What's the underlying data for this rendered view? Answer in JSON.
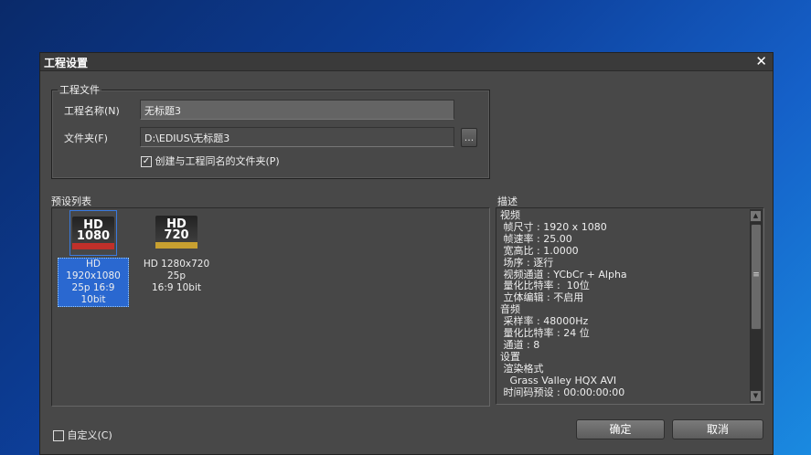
{
  "dialog": {
    "title": "工程设置",
    "close": "✕"
  },
  "project_file": {
    "legend": "工程文件",
    "name_label": "工程名称(N)",
    "name_value": "无标题3",
    "folder_label": "文件夹(F)",
    "folder_value": "D:\\EDIUS\\无标题3",
    "browse": "...",
    "create_folder_label": "创建与工程同名的文件夹(P)",
    "create_folder_checked": true
  },
  "presets": {
    "label": "预设列表",
    "items": [
      {
        "badge_top": "HD",
        "badge_bottom": "1080",
        "line1": "HD 1920x1080",
        "line2": "25p 16:9 10bit",
        "selected": true,
        "stripe": "#c0302a"
      },
      {
        "badge_top": "HD",
        "badge_bottom": "720",
        "line1": "HD 1280x720 25p",
        "line2": "16:9 10bit",
        "selected": false,
        "stripe": "#c8a030"
      }
    ]
  },
  "description": {
    "label": "描述",
    "lines": [
      "视频",
      " 帧尺寸 : 1920 x 1080",
      " 帧速率 : 25.00",
      " 宽高比 : 1.0000",
      " 场序 : 逐行",
      " 视频通道 : YCbCr + Alpha",
      " 量化比特率 :  10位",
      " 立体编辑 : 不启用",
      "音频",
      " 采样率 : 48000Hz",
      " 量化比特率 : 24 位",
      " 通道 : 8",
      "设置",
      " 渲染格式",
      "   Grass Valley HQX AVI",
      " 时间码预设 : 00:00:00:00"
    ]
  },
  "footer": {
    "custom_label": "自定义(C)",
    "custom_checked": false,
    "ok": "确定",
    "cancel": "取消"
  }
}
